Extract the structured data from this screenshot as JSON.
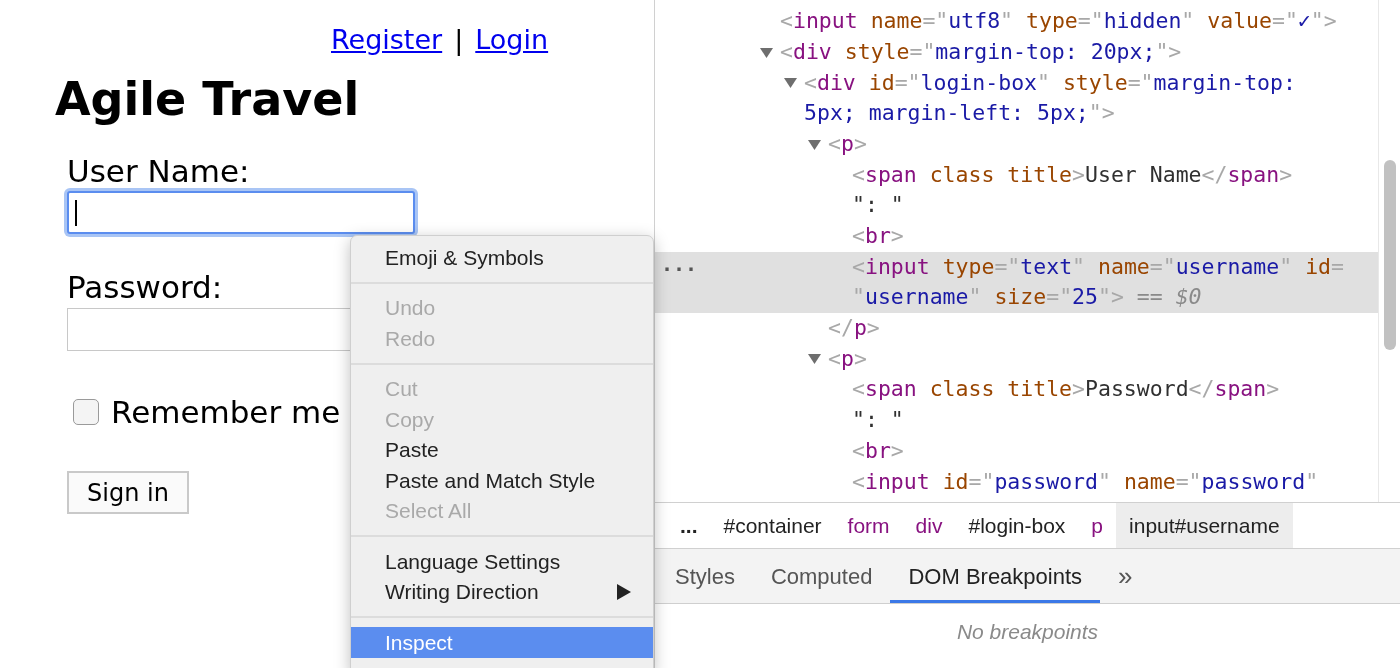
{
  "page": {
    "links": [
      {
        "label": "Register"
      },
      {
        "label": "Login"
      }
    ],
    "link_separator": "|",
    "title": "Agile Travel",
    "fields": [
      {
        "label": "User Name:",
        "focused": true
      },
      {
        "label": "Password:",
        "focused": false
      }
    ],
    "remember": {
      "label": "Remember me",
      "checked": false
    },
    "submit": "Sign in"
  },
  "context_menu": {
    "groups": [
      [
        {
          "label": "Emoji & Symbols",
          "disabled": false,
          "selected": false
        }
      ],
      [
        {
          "label": "Undo",
          "disabled": true,
          "selected": false
        },
        {
          "label": "Redo",
          "disabled": true,
          "selected": false
        }
      ],
      [
        {
          "label": "Cut",
          "disabled": true,
          "selected": false
        },
        {
          "label": "Copy",
          "disabled": true,
          "selected": false
        },
        {
          "label": "Paste",
          "disabled": false,
          "selected": false
        },
        {
          "label": "Paste and Match Style",
          "disabled": false,
          "selected": false
        },
        {
          "label": "Select All",
          "disabled": true,
          "selected": false
        }
      ],
      [
        {
          "label": "Language Settings",
          "disabled": false,
          "selected": false
        },
        {
          "label": "Writing Direction",
          "disabled": false,
          "selected": false,
          "submenu": true
        }
      ],
      [
        {
          "label": "Inspect",
          "disabled": false,
          "selected": true
        }
      ]
    ]
  },
  "elements": {
    "selected_marker": "...",
    "nodes": [
      {
        "selected": false,
        "lines": [
          [
            {
              "kind": "punct",
              "text": "<"
            },
            {
              "kind": "tag",
              "text": "input"
            },
            {
              "kind": "attr",
              "text": " name"
            },
            {
              "kind": "punct",
              "text": "=\""
            },
            {
              "kind": "value",
              "text": "utf8"
            },
            {
              "kind": "punct",
              "text": "\""
            },
            {
              "kind": "attr",
              "text": " type"
            },
            {
              "kind": "punct",
              "text": "=\""
            },
            {
              "kind": "value",
              "text": "hidden"
            },
            {
              "kind": "punct",
              "text": "\""
            },
            {
              "kind": "attr",
              "text": " value"
            },
            {
              "kind": "punct",
              "text": "=\""
            },
            {
              "kind": "value",
              "text": "✓"
            },
            {
              "kind": "punct",
              "text": "\">"
            }
          ]
        ]
      },
      {
        "selected": false,
        "expanded": true,
        "lines": [
          [
            {
              "kind": "punct",
              "text": "<"
            },
            {
              "kind": "tag",
              "text": "div"
            },
            {
              "kind": "attr",
              "text": " style"
            },
            {
              "kind": "punct",
              "text": "=\""
            },
            {
              "kind": "value",
              "text": "margin-top: 20px;"
            },
            {
              "kind": "punct",
              "text": "\">"
            }
          ]
        ],
        "children": [
          {
            "selected": false,
            "expanded": true,
            "lines": [
              [
                {
                  "kind": "punct",
                  "text": "<"
                },
                {
                  "kind": "tag",
                  "text": "div"
                },
                {
                  "kind": "attr",
                  "text": " id"
                },
                {
                  "kind": "punct",
                  "text": "=\""
                },
                {
                  "kind": "value",
                  "text": "login-box"
                },
                {
                  "kind": "punct",
                  "text": "\""
                },
                {
                  "kind": "attr",
                  "text": " style"
                },
                {
                  "kind": "punct",
                  "text": "=\""
                },
                {
                  "kind": "value",
                  "text": "margin-top:"
                }
              ],
              [
                {
                  "kind": "value",
                  "text": "5px; margin-left: 5px;"
                },
                {
                  "kind": "punct",
                  "text": "\">"
                }
              ]
            ],
            "children": [
              {
                "selected": false,
                "expanded": true,
                "lines": [
                  [
                    {
                      "kind": "punct",
                      "text": "<"
                    },
                    {
                      "kind": "tag",
                      "text": "p"
                    },
                    {
                      "kind": "punct",
                      "text": ">"
                    }
                  ]
                ],
                "children": [
                  {
                    "selected": false,
                    "lines": [
                      [
                        {
                          "kind": "punct",
                          "text": "<"
                        },
                        {
                          "kind": "tag",
                          "text": "span"
                        },
                        {
                          "kind": "attr",
                          "text": " class title"
                        },
                        {
                          "kind": "punct",
                          "text": ">"
                        },
                        {
                          "kind": "text",
                          "text": "User Name"
                        },
                        {
                          "kind": "punct",
                          "text": "</"
                        },
                        {
                          "kind": "tag",
                          "text": "span"
                        },
                        {
                          "kind": "punct",
                          "text": ">"
                        }
                      ]
                    ]
                  },
                  {
                    "selected": false,
                    "lines": [
                      [
                        {
                          "kind": "text",
                          "text": "\": \""
                        }
                      ]
                    ]
                  },
                  {
                    "selected": false,
                    "lines": [
                      [
                        {
                          "kind": "punct",
                          "text": "<"
                        },
                        {
                          "kind": "tag",
                          "text": "br"
                        },
                        {
                          "kind": "punct",
                          "text": ">"
                        }
                      ]
                    ]
                  },
                  {
                    "selected": true,
                    "lines": [
                      [
                        {
                          "kind": "punct",
                          "text": "<"
                        },
                        {
                          "kind": "tag",
                          "text": "input"
                        },
                        {
                          "kind": "attr",
                          "text": " type"
                        },
                        {
                          "kind": "punct",
                          "text": "=\""
                        },
                        {
                          "kind": "value",
                          "text": "text"
                        },
                        {
                          "kind": "punct",
                          "text": "\""
                        },
                        {
                          "kind": "attr",
                          "text": " name"
                        },
                        {
                          "kind": "punct",
                          "text": "=\""
                        },
                        {
                          "kind": "value",
                          "text": "username"
                        },
                        {
                          "kind": "punct",
                          "text": "\""
                        },
                        {
                          "kind": "attr",
                          "text": " id"
                        },
                        {
                          "kind": "punct",
                          "text": "="
                        }
                      ],
                      [
                        {
                          "kind": "punct",
                          "text": "\""
                        },
                        {
                          "kind": "value",
                          "text": "username"
                        },
                        {
                          "kind": "punct",
                          "text": "\""
                        },
                        {
                          "kind": "attr",
                          "text": " size"
                        },
                        {
                          "kind": "punct",
                          "text": "=\""
                        },
                        {
                          "kind": "value",
                          "text": "25"
                        },
                        {
                          "kind": "punct",
                          "text": "\">"
                        },
                        {
                          "kind": "dim",
                          "text": " == "
                        },
                        {
                          "kind": "var",
                          "text": "$0"
                        }
                      ]
                    ]
                  }
                ],
                "close": [
                  {
                    "kind": "punct",
                    "text": "</"
                  },
                  {
                    "kind": "tag",
                    "text": "p"
                  },
                  {
                    "kind": "punct",
                    "text": ">"
                  }
                ]
              },
              {
                "selected": false,
                "expanded": true,
                "lines": [
                  [
                    {
                      "kind": "punct",
                      "text": "<"
                    },
                    {
                      "kind": "tag",
                      "text": "p"
                    },
                    {
                      "kind": "punct",
                      "text": ">"
                    }
                  ]
                ],
                "children": [
                  {
                    "selected": false,
                    "lines": [
                      [
                        {
                          "kind": "punct",
                          "text": "<"
                        },
                        {
                          "kind": "tag",
                          "text": "span"
                        },
                        {
                          "kind": "attr",
                          "text": " class title"
                        },
                        {
                          "kind": "punct",
                          "text": ">"
                        },
                        {
                          "kind": "text",
                          "text": "Password"
                        },
                        {
                          "kind": "punct",
                          "text": "</"
                        },
                        {
                          "kind": "tag",
                          "text": "span"
                        },
                        {
                          "kind": "punct",
                          "text": ">"
                        }
                      ]
                    ]
                  },
                  {
                    "selected": false,
                    "lines": [
                      [
                        {
                          "kind": "text",
                          "text": "\": \""
                        }
                      ]
                    ]
                  },
                  {
                    "selected": false,
                    "lines": [
                      [
                        {
                          "kind": "punct",
                          "text": "<"
                        },
                        {
                          "kind": "tag",
                          "text": "br"
                        },
                        {
                          "kind": "punct",
                          "text": ">"
                        }
                      ]
                    ]
                  },
                  {
                    "selected": false,
                    "lines": [
                      [
                        {
                          "kind": "punct",
                          "text": "<"
                        },
                        {
                          "kind": "tag",
                          "text": "input"
                        },
                        {
                          "kind": "attr",
                          "text": " id"
                        },
                        {
                          "kind": "punct",
                          "text": "=\""
                        },
                        {
                          "kind": "value",
                          "text": "password"
                        },
                        {
                          "kind": "punct",
                          "text": "\""
                        },
                        {
                          "kind": "attr",
                          "text": " name"
                        },
                        {
                          "kind": "punct",
                          "text": "=\""
                        },
                        {
                          "kind": "value",
                          "text": "password"
                        },
                        {
                          "kind": "punct",
                          "text": "\""
                        }
                      ]
                    ]
                  }
                ]
              }
            ]
          }
        ]
      }
    ]
  },
  "breadcrumbs": [
    {
      "label": "...",
      "kind": "more",
      "selected": false
    },
    {
      "label": "#container",
      "kind": "id",
      "selected": false
    },
    {
      "label": "form",
      "kind": "tag",
      "selected": false
    },
    {
      "label": "div",
      "kind": "tag",
      "selected": false
    },
    {
      "label": "#login-box",
      "kind": "id",
      "selected": false
    },
    {
      "label": "p",
      "kind": "tag",
      "selected": false
    },
    {
      "label": "input#username",
      "kind": "id",
      "selected": true
    }
  ],
  "sidebar_tabs": [
    {
      "label": "Styles",
      "selected": false
    },
    {
      "label": "Computed",
      "selected": false
    },
    {
      "label": "DOM Breakpoints",
      "selected": true
    }
  ],
  "sidebar_overflow": "»",
  "empty_message": "No breakpoints"
}
